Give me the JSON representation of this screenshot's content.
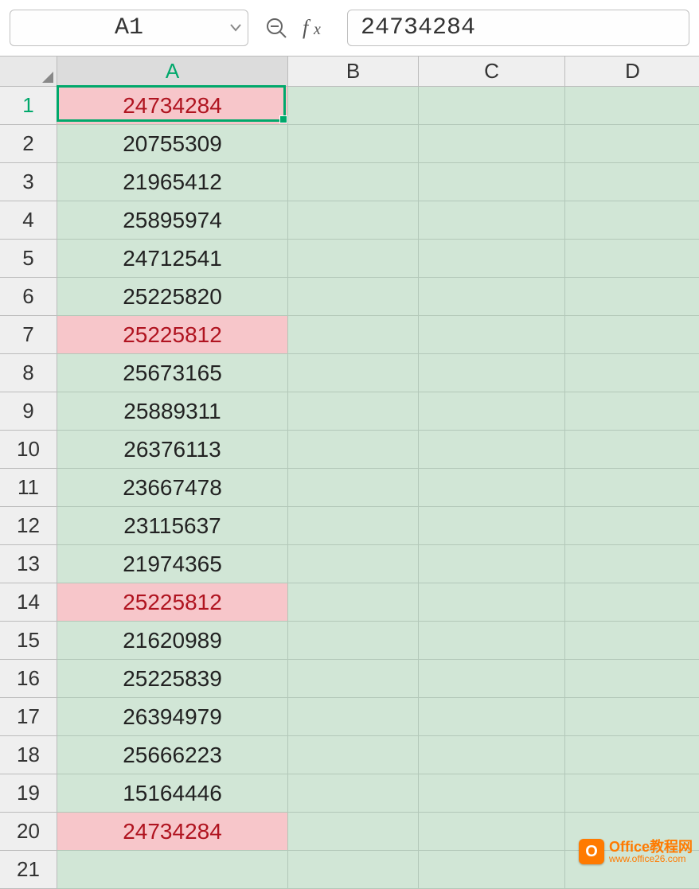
{
  "namebox": {
    "value": "A1"
  },
  "formula": {
    "value": "24734284"
  },
  "columns": [
    "A",
    "B",
    "C",
    "D"
  ],
  "active": {
    "row": 1,
    "col": "A"
  },
  "rows": [
    {
      "n": 1,
      "a": "24734284",
      "highlight": true
    },
    {
      "n": 2,
      "a": "20755309",
      "highlight": false
    },
    {
      "n": 3,
      "a": "21965412",
      "highlight": false
    },
    {
      "n": 4,
      "a": "25895974",
      "highlight": false
    },
    {
      "n": 5,
      "a": "24712541",
      "highlight": false
    },
    {
      "n": 6,
      "a": "25225820",
      "highlight": false
    },
    {
      "n": 7,
      "a": "25225812",
      "highlight": true
    },
    {
      "n": 8,
      "a": "25673165",
      "highlight": false
    },
    {
      "n": 9,
      "a": "25889311",
      "highlight": false
    },
    {
      "n": 10,
      "a": "26376113",
      "highlight": false
    },
    {
      "n": 11,
      "a": "23667478",
      "highlight": false
    },
    {
      "n": 12,
      "a": "23115637",
      "highlight": false
    },
    {
      "n": 13,
      "a": "21974365",
      "highlight": false
    },
    {
      "n": 14,
      "a": "25225812",
      "highlight": true
    },
    {
      "n": 15,
      "a": "21620989",
      "highlight": false
    },
    {
      "n": 16,
      "a": "25225839",
      "highlight": false
    },
    {
      "n": 17,
      "a": "26394979",
      "highlight": false
    },
    {
      "n": 18,
      "a": "25666223",
      "highlight": false
    },
    {
      "n": 19,
      "a": "15164446",
      "highlight": false
    },
    {
      "n": 20,
      "a": "24734284",
      "highlight": true
    },
    {
      "n": 21,
      "a": "",
      "highlight": false
    }
  ],
  "watermark": {
    "title": "Office教程网",
    "url": "www.office26.com",
    "badge": "O"
  }
}
